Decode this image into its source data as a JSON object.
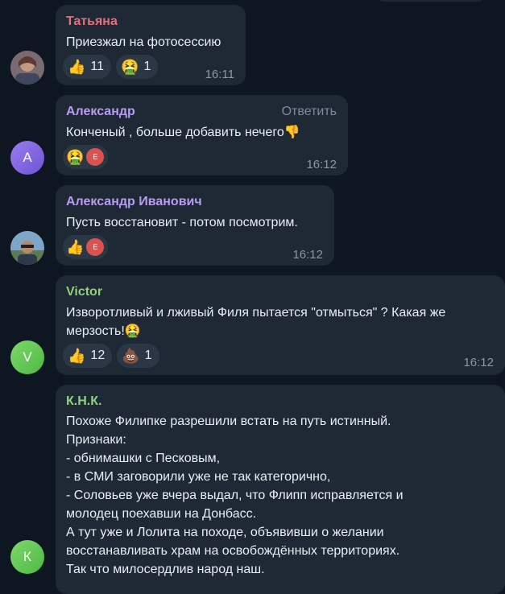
{
  "messages": [
    {
      "author": "Татьяна",
      "text": [
        "Приезжал на фотосессию"
      ],
      "reactions": [
        {
          "emoji": "👍",
          "count": "11"
        },
        {
          "emoji": "🤮",
          "count": "1"
        }
      ],
      "time": "16:11"
    },
    {
      "author": "Александр",
      "reply_label": "Ответить",
      "text": [
        "Конченый  , больше добавить нечего👎"
      ],
      "reactions": [
        {
          "emoji": "🤮"
        }
      ],
      "reactor_initial": "E",
      "avatar_initial": "А",
      "time": "16:12"
    },
    {
      "author": "Александр Иванович",
      "text": [
        "Пусть восстановит - потом посмотрим."
      ],
      "reactions": [
        {
          "emoji": "👍"
        }
      ],
      "reactor_initial": "E",
      "time": "16:12"
    },
    {
      "author": "Victor",
      "text": [
        "Изворотливый и лживый Филя пытается \"отмыться\" ? Какая же",
        "мерзость!🤮"
      ],
      "reactions": [
        {
          "emoji": "👍",
          "count": "12"
        },
        {
          "emoji": "💩",
          "count": "1"
        }
      ],
      "avatar_initial": "V",
      "time": "16:12"
    },
    {
      "author": "К.Н.К.",
      "text": [
        "Похоже Филипке разрешили встать на путь истинный.",
        "Признаки:",
        "- обнимашки с Песковым,",
        "- в СМИ заговорили уже не так категорично,",
        "- Соловьев уже вчера выдал, что Флипп исправляется и",
        "молодец поехавши на Донбасс.",
        "А тут уже и Лолита на походе, объявивши о желании",
        "восстанавливать храм на освобождённых территориях.",
        "Так что милосердлив народ наш."
      ],
      "avatar_initial": "К"
    }
  ],
  "colors": {
    "bg": "#0e1621",
    "bubble": "#1f2936",
    "name_red": "#e5707a",
    "name_purple": "#b79cf2",
    "name_green": "#8fd07b"
  }
}
